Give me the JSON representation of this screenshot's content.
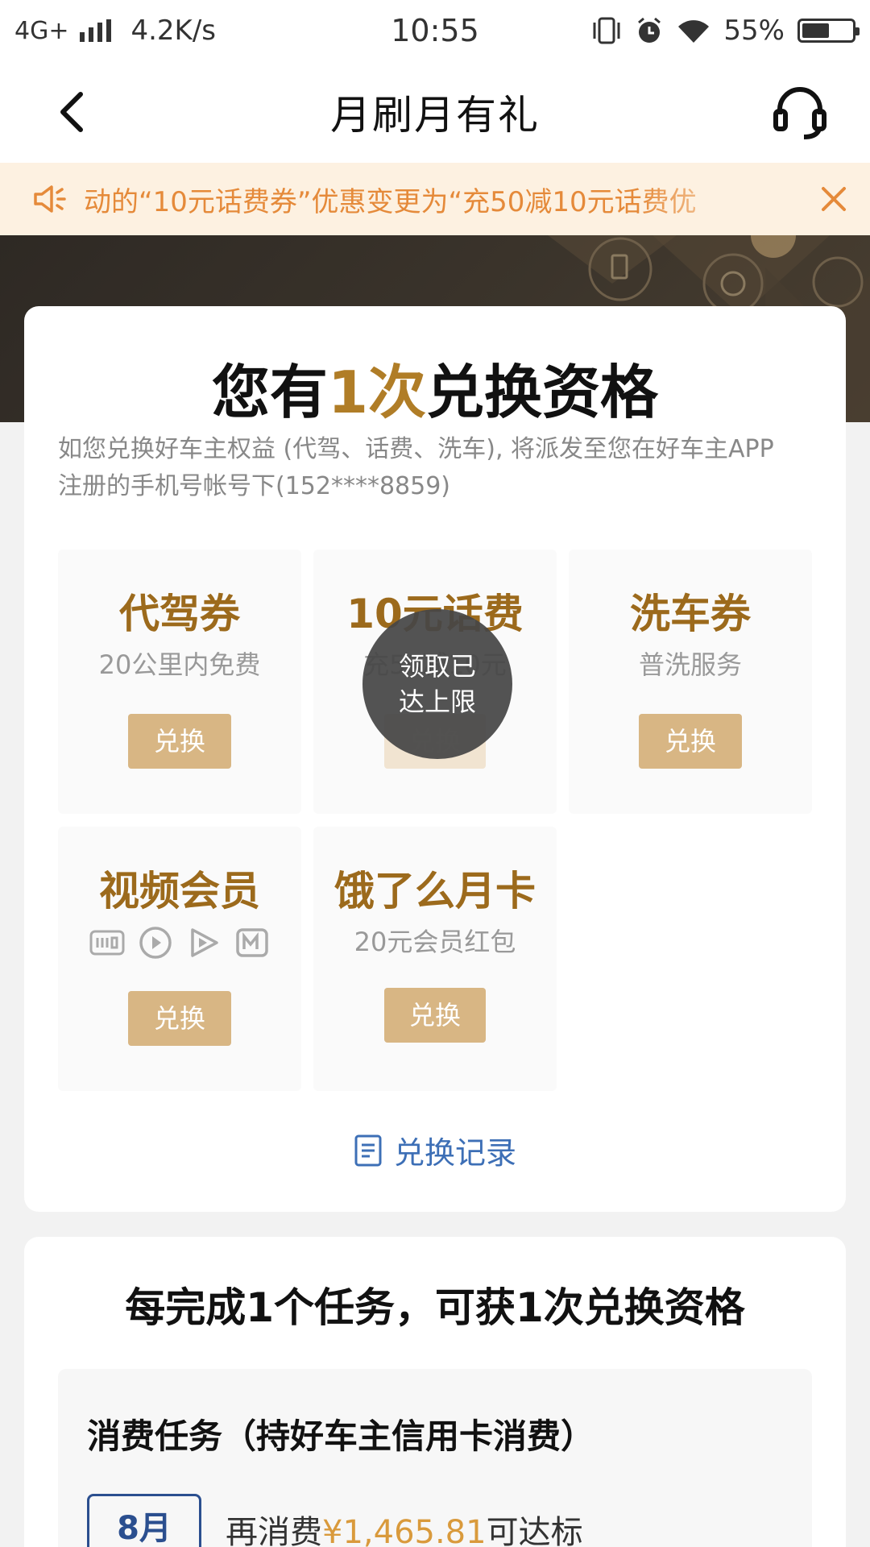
{
  "status_bar": {
    "network": "4G+",
    "speed": "4.2K/s",
    "time": "10:55",
    "battery": "55%",
    "battery_level": 0.55
  },
  "nav": {
    "title": "月刷月有礼",
    "back_icon": "chevron-left-icon",
    "support_icon": "headset-icon"
  },
  "notice": {
    "text": "动的“10元话费券”优惠变更为“充50减10元话费优"
  },
  "card": {
    "title_prefix": "您有",
    "title_count": "1次",
    "title_suffix": "兑换资格",
    "desc_line1": "如您兑换好车主权益 (代驾、话费、洗车), 将派发至您在好车主APP",
    "desc_line2": "注册的手机号帐号下(152****8859)",
    "tiles": [
      {
        "name": "代驾券",
        "sub": "20公里内免费",
        "button": "兑换"
      },
      {
        "name": "10元话费",
        "sub": "充50减10元",
        "button": "兑换"
      },
      {
        "name": "洗车券",
        "sub": "普洗服务",
        "button": "兑换"
      },
      {
        "name": "视频会员",
        "sub": "",
        "button": "兑换"
      },
      {
        "name": "饿了么月卡",
        "sub": "20元会员红包",
        "button": "兑换"
      }
    ],
    "toast": "领取已达上限",
    "records": "兑换记录"
  },
  "tasks": {
    "title": "每完成1个任务，可获1次兑换资格",
    "section_title": "消费任务（持好车主信用卡消费）",
    "month": "8月",
    "progress_prefix": "再消费",
    "progress_amount": "¥1,465.81",
    "progress_suffix": "可达标"
  },
  "colors": {
    "accent": "#b07d27",
    "button": "#d8b684",
    "notice_bg": "#fdf1e1",
    "notice_text": "#e58a3a",
    "link": "#3d6fb6"
  }
}
